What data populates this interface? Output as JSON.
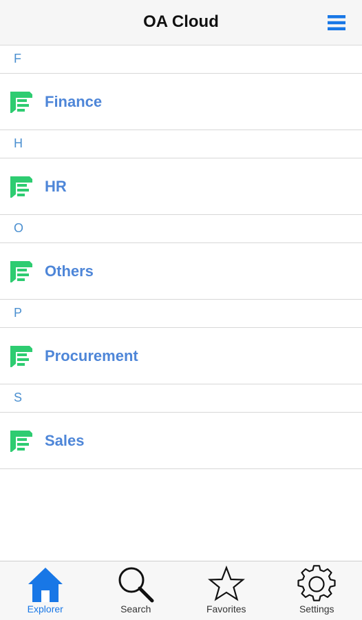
{
  "header": {
    "title": "OA Cloud",
    "menu_icon": "hamburger-menu-icon"
  },
  "colors": {
    "accent": "#1877e6",
    "section_letter": "#4a8fd0",
    "item_label": "#4e86d8",
    "item_icon": "#2ecc71"
  },
  "sections": [
    {
      "letter": "F",
      "item": {
        "label": "Finance",
        "icon": "folder-list-icon"
      }
    },
    {
      "letter": "H",
      "item": {
        "label": "HR",
        "icon": "folder-list-icon"
      }
    },
    {
      "letter": "O",
      "item": {
        "label": "Others",
        "icon": "folder-list-icon"
      }
    },
    {
      "letter": "P",
      "item": {
        "label": "Procurement",
        "icon": "folder-list-icon"
      }
    },
    {
      "letter": "S",
      "item": {
        "label": "Sales",
        "icon": "folder-list-icon"
      }
    }
  ],
  "tabbar": {
    "active": "Explorer",
    "tabs": [
      {
        "label": "Explorer",
        "icon": "home-icon"
      },
      {
        "label": "Search",
        "icon": "search-icon"
      },
      {
        "label": "Favorites",
        "icon": "star-icon"
      },
      {
        "label": "Settings",
        "icon": "gear-icon"
      }
    ]
  }
}
